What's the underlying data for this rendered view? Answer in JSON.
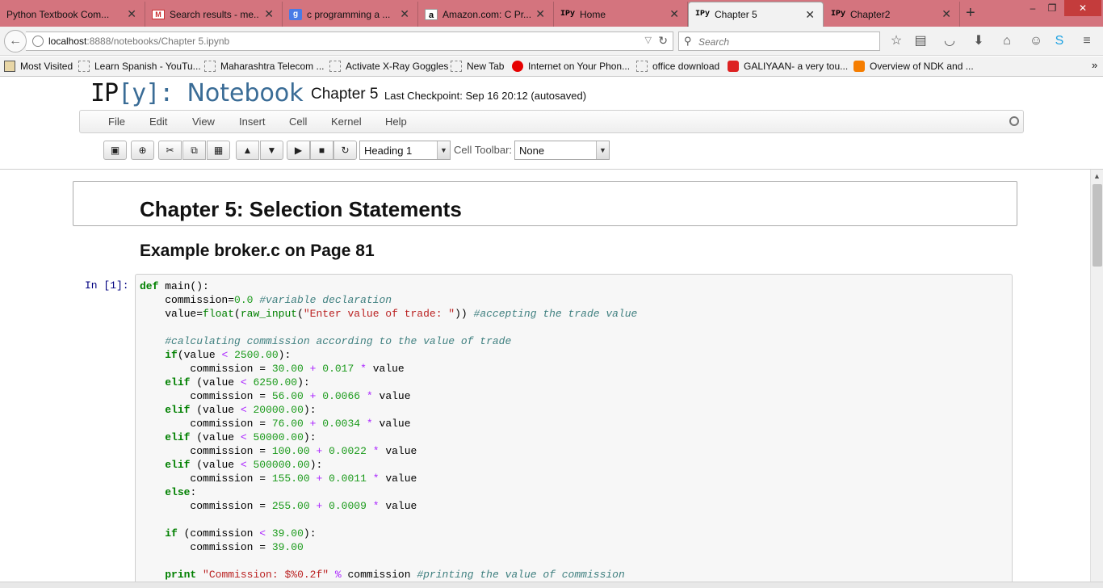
{
  "browser": {
    "tabs": [
      {
        "label": "Python Textbook Com...",
        "favicon": "none"
      },
      {
        "label": "Search results - me...",
        "favicon": "gmail-icon"
      },
      {
        "label": "c programming a ...",
        "favicon": "google-icon"
      },
      {
        "label": "Amazon.com: C Pr...",
        "favicon": "amazon-icon"
      },
      {
        "label": "Home",
        "favicon": "ipy-icon"
      },
      {
        "label": "Chapter 5",
        "favicon": "ipy-icon",
        "active": true
      },
      {
        "label": "Chapter2",
        "favicon": "ipy-icon"
      }
    ],
    "url_host": "localhost",
    "url_rest": ":8888/notebooks/Chapter 5.ipynb",
    "search_placeholder": "Search",
    "bookmarks": [
      "Most Visited",
      "Learn Spanish - YouTu...",
      "Maharashtra Telecom ...",
      "Activate X-Ray Goggles",
      "New Tab",
      "Internet on Your Phon...",
      "office download",
      "GALIYAAN- a very tou...",
      "Overview of NDK and ..."
    ]
  },
  "notebook": {
    "logo_ip": "IP",
    "logo_y": "[y]:",
    "logo_text": "Notebook",
    "name": "Chapter 5",
    "checkpoint": "Last Checkpoint: Sep 16 20:12 (autosaved)",
    "menu": [
      "File",
      "Edit",
      "View",
      "Insert",
      "Cell",
      "Kernel",
      "Help"
    ],
    "cell_type_value": "Heading 1",
    "cell_toolbar_label": "Cell Toolbar:",
    "cell_toolbar_value": "None",
    "heading1": "Chapter 5: Selection Statements",
    "heading2": "Example broker.c on Page 81",
    "prompt": "In [1]:"
  },
  "colors": {
    "tabbar": "#d4747e",
    "logo": "#3a6c96",
    "prompt": "#000080"
  }
}
